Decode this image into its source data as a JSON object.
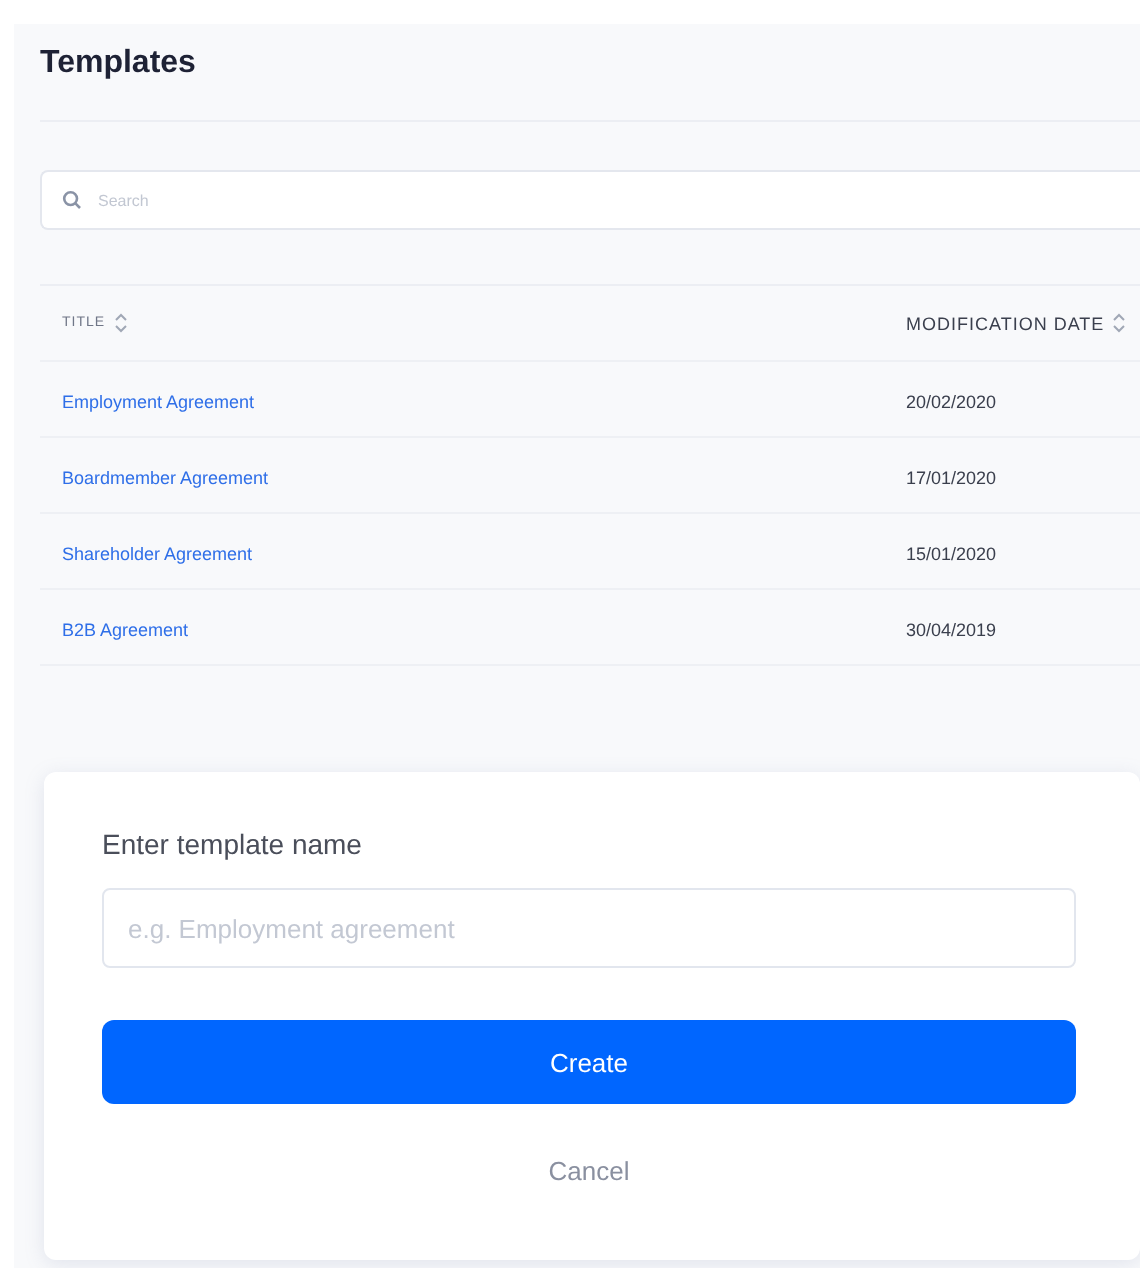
{
  "page": {
    "title": "Templates"
  },
  "search": {
    "placeholder": "Search"
  },
  "table": {
    "columns": [
      {
        "label": "TITLE",
        "sortable": true
      },
      {
        "label": "MODIFICATION DATE",
        "sortable": true
      }
    ],
    "rows": [
      {
        "title": "Employment Agreement",
        "date": "20/02/2020"
      },
      {
        "title": "Boardmember Agreement",
        "date": "17/01/2020"
      },
      {
        "title": "Shareholder Agreement",
        "date": "15/01/2020"
      },
      {
        "title": "B2B Agreement",
        "date": "30/04/2019"
      }
    ]
  },
  "dialog": {
    "label": "Enter template name",
    "input": {
      "placeholder": "e.g. Employment agreement"
    },
    "primary_button": "Create",
    "secondary_button": "Cancel"
  }
}
